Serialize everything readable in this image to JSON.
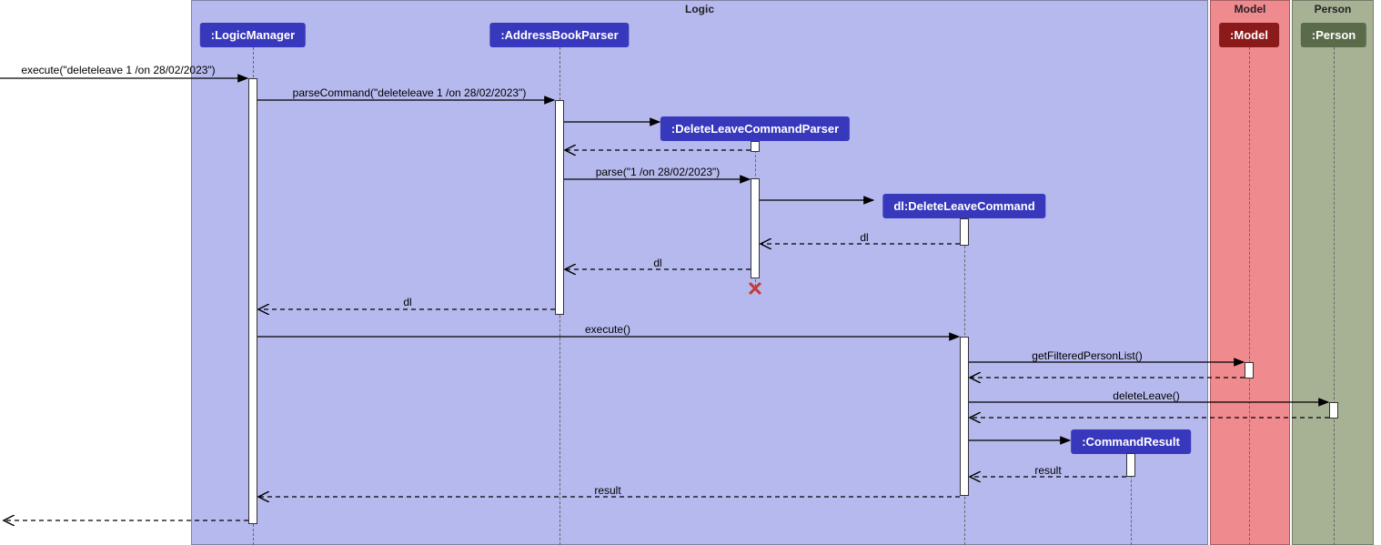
{
  "regions": {
    "logic": "Logic",
    "model": "Model",
    "person": "Person"
  },
  "participants": {
    "logicManager": ":LogicManager",
    "addressBookParser": ":AddressBookParser",
    "deleteLeaveCommandParser": ":DeleteLeaveCommandParser",
    "deleteLeaveCommand": "dl:DeleteLeaveCommand",
    "commandResult": ":CommandResult",
    "model": ":Model",
    "person": ":Person"
  },
  "messages": {
    "executeIn": "execute(\"deleteleave 1 /on 28/02/2023\")",
    "parseCommand": "parseCommand(\"deleteleave 1 /on 28/02/2023\")",
    "parse": "parse(\"1 /on 28/02/2023\")",
    "dl1": "dl",
    "dl2": "dl",
    "dl3": "dl",
    "execute": "execute()",
    "getFilteredPersonList": "getFilteredPersonList()",
    "deleteLeave": "deleteLeave()",
    "result1": "result",
    "result2": "result"
  }
}
